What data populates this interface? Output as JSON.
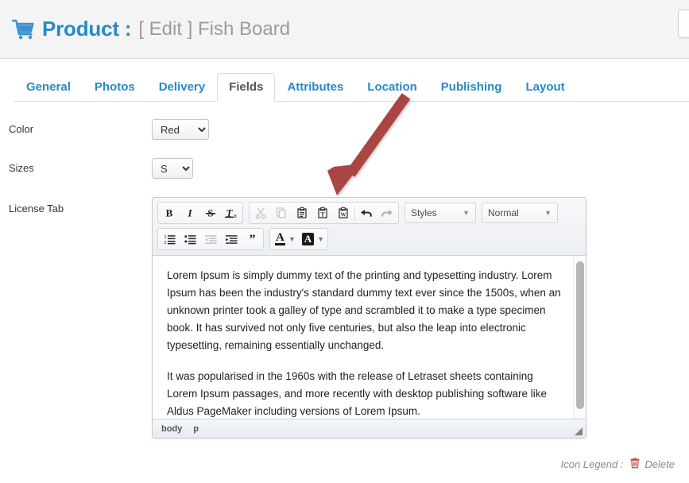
{
  "header": {
    "icon": "shopping-cart-icon",
    "title": "Product :",
    "subtitle": "[ Edit ] Fish Board",
    "brand_color": "#2789c8",
    "subtitle_color": "#9b9b9b"
  },
  "tabs": [
    {
      "label": "General",
      "active": false
    },
    {
      "label": "Photos",
      "active": false
    },
    {
      "label": "Delivery",
      "active": false
    },
    {
      "label": "Fields",
      "active": true
    },
    {
      "label": "Attributes",
      "active": false
    },
    {
      "label": "Location",
      "active": false
    },
    {
      "label": "Publishing",
      "active": false
    },
    {
      "label": "Layout",
      "active": false
    }
  ],
  "fields": {
    "color": {
      "label": "Color",
      "value": "Red",
      "options": [
        "Red"
      ]
    },
    "sizes": {
      "label": "Sizes",
      "value": "S",
      "options": [
        "S"
      ]
    },
    "license_tab": {
      "label": "License Tab"
    }
  },
  "editor": {
    "toolbar_row1": [
      {
        "name": "bold-button",
        "glyph": "B",
        "disabled": false
      },
      {
        "name": "italic-button",
        "glyph": "I",
        "disabled": false
      },
      {
        "name": "strikethrough-button",
        "glyph": "S",
        "disabled": false
      },
      {
        "name": "remove-format-button",
        "glyph": "Tx",
        "disabled": false
      },
      {
        "name": "cut-button",
        "glyph": "scissors-icon",
        "disabled": true
      },
      {
        "name": "copy-button",
        "glyph": "copy-icon",
        "disabled": true
      },
      {
        "name": "paste-button",
        "glyph": "clipboard-icon",
        "disabled": false
      },
      {
        "name": "paste-as-text-button",
        "glyph": "clipboard-text-icon",
        "disabled": false
      },
      {
        "name": "paste-from-word-button",
        "glyph": "clipboard-word-icon",
        "disabled": false
      },
      {
        "name": "undo-button",
        "glyph": "undo-arrow-icon",
        "disabled": false
      },
      {
        "name": "redo-button",
        "glyph": "redo-arrow-icon",
        "disabled": true
      }
    ],
    "styles_combo": {
      "label": "Styles"
    },
    "format_combo": {
      "label": "Normal"
    },
    "toolbar_row2": [
      {
        "name": "numbered-list-button",
        "glyph": "numbered-list-icon",
        "disabled": false
      },
      {
        "name": "bulleted-list-button",
        "glyph": "bulleted-list-icon",
        "disabled": false
      },
      {
        "name": "outdent-button",
        "glyph": "outdent-icon",
        "disabled": true
      },
      {
        "name": "indent-button",
        "glyph": "indent-icon",
        "disabled": false
      },
      {
        "name": "blockquote-button",
        "glyph": "quote-icon",
        "disabled": false
      }
    ],
    "text_color_button": {
      "label": "A"
    },
    "bg_color_button": {
      "label": "A"
    },
    "content": {
      "paragraph1": "Lorem Ipsum is simply dummy text of the printing and typesetting industry. Lorem Ipsum has been the industry's standard dummy text ever since the 1500s, when an unknown printer took a galley of type and scrambled it to make a type specimen book. It has survived not only five centuries, but also the leap into electronic typesetting, remaining essentially unchanged.",
      "paragraph2": "It was popularised in the 1960s with the release of Letraset sheets containing Lorem Ipsum passages, and more recently with desktop publishing software like Aldus PageMaker including versions of Lorem Ipsum."
    },
    "status": {
      "crumb_body": "body",
      "crumb_element": "p"
    }
  },
  "legend": {
    "label": "Icon Legend :",
    "item_text": "Delete",
    "icon": "trash-icon",
    "icon_color": "#c9524f"
  },
  "annotation": {
    "arrow_color": "#a94442",
    "points_to": "paste-as-text-button"
  }
}
